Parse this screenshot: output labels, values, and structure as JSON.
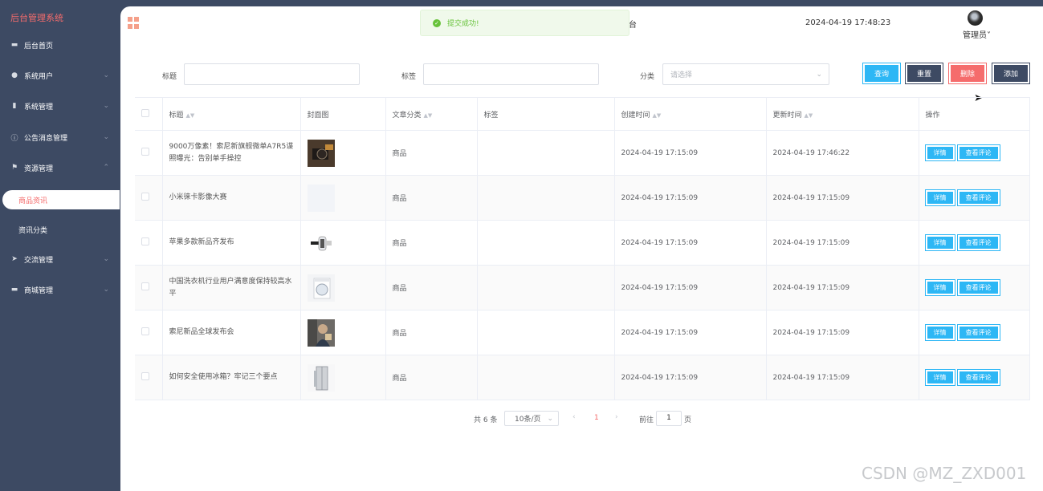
{
  "sidebar": {
    "title": "后台管理系统",
    "items": [
      {
        "label": "后台首页",
        "icon": "monitor-icon",
        "glyph": "▬",
        "arrow": false
      },
      {
        "label": "系统用户",
        "icon": "user-icon",
        "glyph": "●",
        "arrow": true
      },
      {
        "label": "系统管理",
        "icon": "bar-chart-icon",
        "glyph": "▮",
        "arrow": true
      },
      {
        "label": "公告消息管理",
        "icon": "info-icon",
        "glyph": "ⓘ",
        "arrow": true
      },
      {
        "label": "资源管理",
        "icon": "flag-icon",
        "glyph": "⚑",
        "arrow": true,
        "expanded": true
      },
      {
        "label": "交流管理",
        "icon": "send-icon",
        "glyph": "➤",
        "arrow": true
      },
      {
        "label": "商城管理",
        "icon": "shop-icon",
        "glyph": "▬",
        "arrow": true
      }
    ],
    "subitems": [
      {
        "label": "商品资讯",
        "active": true
      },
      {
        "label": "资讯分类",
        "active": false
      }
    ]
  },
  "header": {
    "tab_fragment": "台",
    "datetime": "2024-04-19 17:48:23",
    "user_name": "管理员",
    "user_caret": "˅"
  },
  "toast": {
    "message": "提交成功!",
    "icon": "check-circle-icon"
  },
  "search": {
    "title_label": "标题",
    "title_value": "",
    "tag_label": "标签",
    "tag_value": "",
    "category_label": "分类",
    "category_placeholder": "请选择"
  },
  "buttons": {
    "query": "查询",
    "reset": "重置",
    "delete": "删除",
    "add": "添加"
  },
  "table": {
    "columns": [
      "标题",
      "封面图",
      "文章分类",
      "标签",
      "创建时间",
      "更新时间",
      "操作"
    ],
    "rows": [
      {
        "title": "9000万像素！索尼新旗舰微单A7R5谍照曝光：告别单手操控",
        "category": "商品",
        "tag": "",
        "created": "2024-04-19 17:15:09",
        "updated": "2024-04-19 17:46:22",
        "cover": "camera-image"
      },
      {
        "title": "小米徕卡影像大赛",
        "category": "商品",
        "tag": "",
        "created": "2024-04-19 17:15:09",
        "updated": "2024-04-19 17:15:09",
        "cover": "blank-image"
      },
      {
        "title": "苹果多款新品齐发布",
        "category": "商品",
        "tag": "",
        "created": "2024-04-19 17:15:09",
        "updated": "2024-04-19 17:15:09",
        "cover": "band-image"
      },
      {
        "title": "中国洗衣机行业用户满意度保持较高水平",
        "category": "商品",
        "tag": "",
        "created": "2024-04-19 17:15:09",
        "updated": "2024-04-19 17:15:09",
        "cover": "washer-image"
      },
      {
        "title": "索尼新品全球发布会",
        "category": "商品",
        "tag": "",
        "created": "2024-04-19 17:15:09",
        "updated": "2024-04-19 17:15:09",
        "cover": "person-image"
      },
      {
        "title": "如何安全使用冰箱？牢记三个要点",
        "category": "商品",
        "tag": "",
        "created": "2024-04-19 17:15:09",
        "updated": "2024-04-19 17:15:09",
        "cover": "fridge-image"
      }
    ],
    "detail_label": "详情",
    "comment_label": "查看评论"
  },
  "pagination": {
    "total": "共 6 条",
    "page_size": "10条/页",
    "current": "1",
    "goto_label": "前往",
    "goto_value": "1",
    "page_suffix": "页"
  },
  "watermark": "CSDN @MZ_ZXD001"
}
